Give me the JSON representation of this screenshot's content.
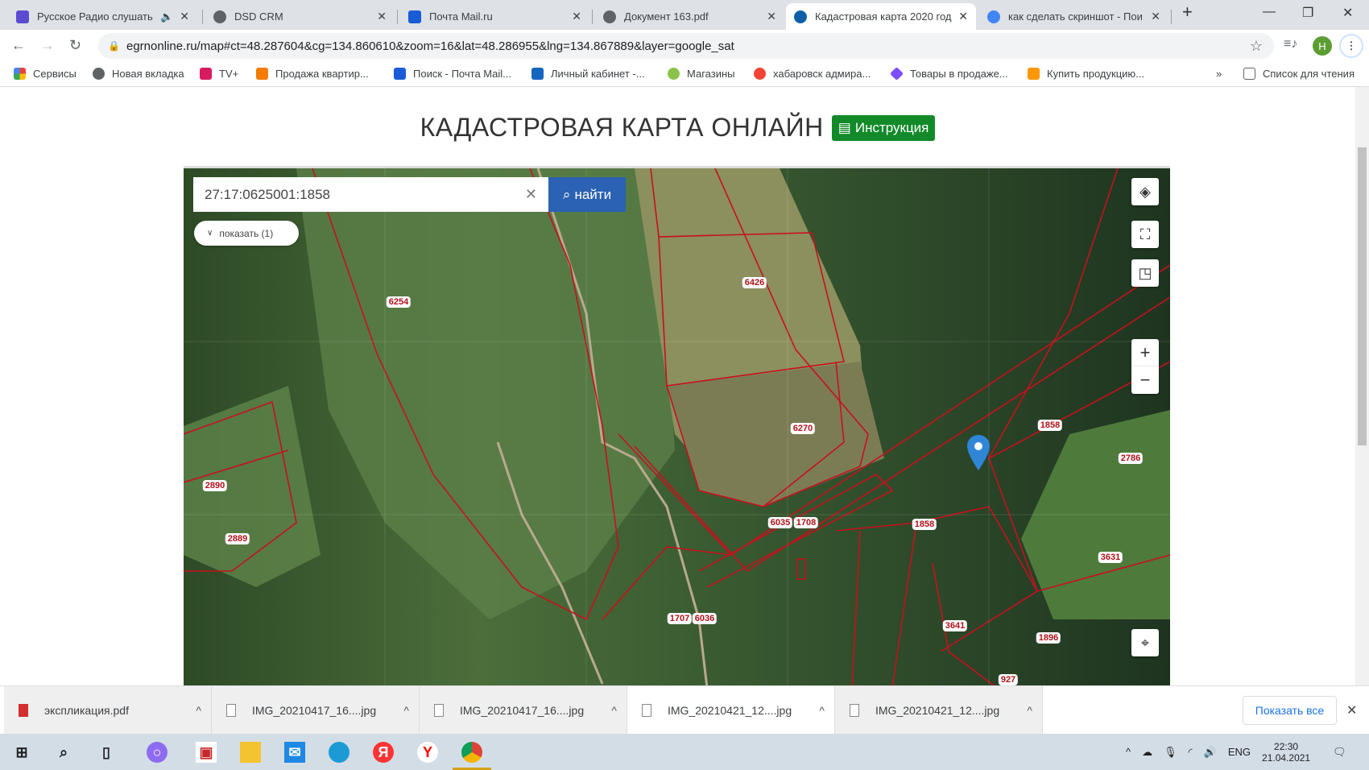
{
  "tabs": [
    {
      "label": "Русское Радио слушать",
      "color": "#5a4bd1"
    },
    {
      "label": "DSD CRM",
      "color": "#5f6368"
    },
    {
      "label": "Почта Mail.ru",
      "color": "#1a5bd8"
    },
    {
      "label": "Документ 163.pdf",
      "color": "#5f6368"
    },
    {
      "label": "Кадастровая карта 2020 год",
      "color": "#0d5fa8"
    },
    {
      "label": "как сделать скриншот - Пои",
      "color": "#4285f4"
    }
  ],
  "url": "egrnonline.ru/map#ct=48.287604&cg=134.860610&zoom=16&lat=48.286955&lng=134.867889&layer=google_sat",
  "profile_initial": "H",
  "bookmarks": [
    {
      "label": "Сервисы",
      "color": "#ea4335"
    },
    {
      "label": "Новая вкладка",
      "color": "#5f6368"
    },
    {
      "label": "TV+",
      "color": "#d81b60"
    },
    {
      "label": "Продажа квартир...",
      "color": "#f57c00"
    },
    {
      "label": "Поиск - Почта Mail...",
      "color": "#1a5bd8"
    },
    {
      "label": "Личный кабинет -...",
      "color": "#1565c0"
    },
    {
      "label": "Магазины",
      "color": "#8bc34a"
    },
    {
      "label": "хабаровск адмира...",
      "color": "#f44336"
    },
    {
      "label": "Товары в продаже...",
      "color": "#7c4dff"
    },
    {
      "label": "Купить продукцию...",
      "color": "#ff9800"
    }
  ],
  "reading_list": "Список для чтения",
  "page": {
    "title": "КАДАСТРОВАЯ КАРТА ОНЛАЙН",
    "instruction_button": "Инструкция"
  },
  "search": {
    "value": "27:17:0625001:1858",
    "button": "найти",
    "show_results": "показать (1)"
  },
  "map_labels": [
    "6254",
    "6426",
    "6270",
    "2890",
    "2889",
    "6035",
    "1708",
    "1858",
    "1858",
    "2786",
    "3631",
    "3641",
    "1896",
    "1707",
    "6036",
    "927"
  ],
  "downloads": [
    {
      "name": "экспликация.pdf"
    },
    {
      "name": "IMG_20210417_16....jpg"
    },
    {
      "name": "IMG_20210417_16....jpg"
    },
    {
      "name": "IMG_20210421_12....jpg"
    },
    {
      "name": "IMG_20210421_12....jpg"
    }
  ],
  "show_all": "Показать все",
  "tray": {
    "lang": "ENG",
    "time": "22:30",
    "date": "21.04.2021"
  }
}
